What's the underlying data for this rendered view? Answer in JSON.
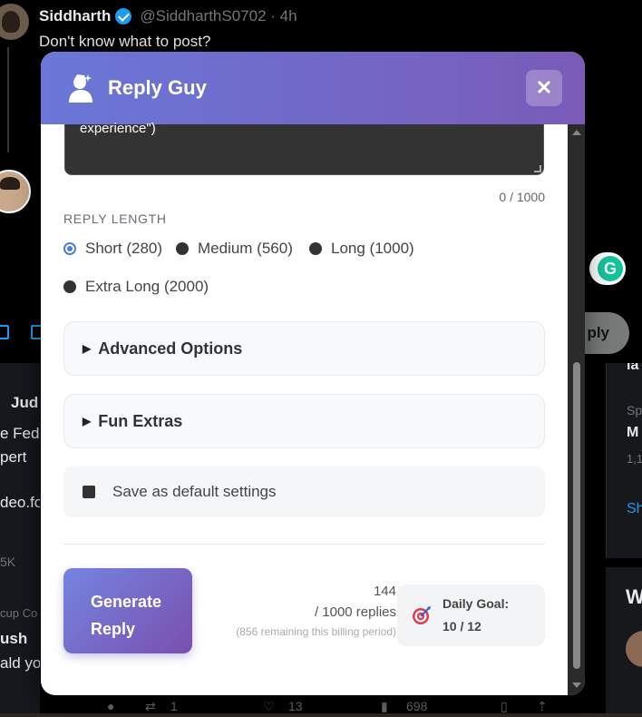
{
  "background": {
    "tweet": {
      "author": "Siddharth",
      "handle": "@SiddharthS0702 · 4h",
      "text": "Don't know what to post?"
    },
    "reply_button": "ply",
    "feed_left_fragments": [
      "Jud",
      "e Fed",
      "pert",
      "deo.fo",
      "5K",
      "cup Co",
      "ush",
      "ald you"
    ],
    "right_col_fragments": [
      "la",
      "Sp",
      "M",
      "1,1",
      "Sh",
      "W"
    ],
    "bottom_bar": {
      "retweets": "1",
      "likes": "13",
      "views": "698"
    }
  },
  "modal": {
    "title": "Reply Guy",
    "close_symbol": "✕",
    "textarea_text": "experience\")",
    "char_count": "0 / 1000",
    "reply_length_label": "REPLY LENGTH",
    "reply_length_options": [
      {
        "label": "Short (280)",
        "selected": true
      },
      {
        "label": "Medium (560)",
        "selected": false
      },
      {
        "label": "Long (1000)",
        "selected": false
      },
      {
        "label": "Extra Long (2000)",
        "selected": false
      }
    ],
    "advanced_options": "Advanced Options",
    "fun_extras": "Fun Extras",
    "save_default": "Save as default settings",
    "generate_line1": "Generate",
    "generate_line2": "Reply",
    "usage_count": "144",
    "usage_limit": "/ 1000 replies",
    "usage_remaining": "(856 remaining this billing period)",
    "daily_goal_label": "Daily Goal:",
    "daily_goal_value": "10 / 12"
  },
  "colors": {
    "header_gradient_start": "#6a77d8",
    "header_gradient_end": "#7a5bb8",
    "radio_selected": "#4a7dde"
  }
}
